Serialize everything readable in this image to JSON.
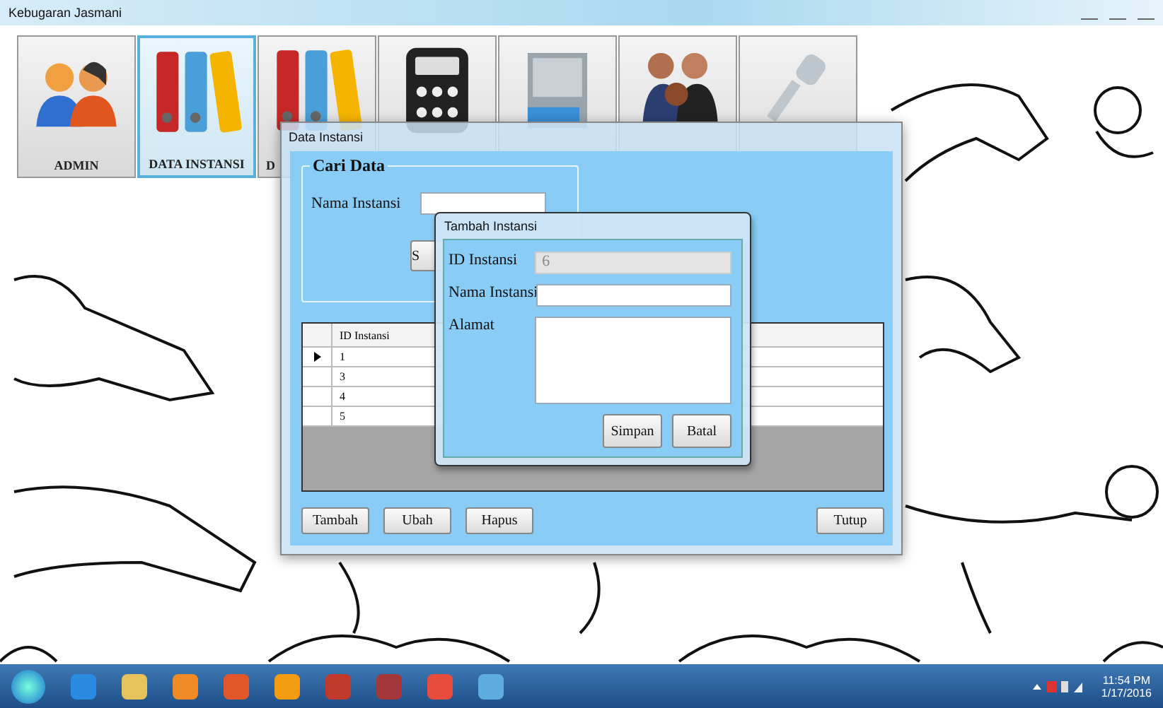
{
  "window": {
    "title": "Kebugaran Jasmani"
  },
  "menu_tiles": [
    {
      "kind": "people",
      "label": "ADMIN",
      "selected": false
    },
    {
      "kind": "binders",
      "label": "DATA INSTANSI",
      "selected": true
    },
    {
      "kind": "binders",
      "label": "D",
      "selected": false
    },
    {
      "kind": "calculator",
      "selected": false
    },
    {
      "kind": "cabinet",
      "selected": false
    },
    {
      "kind": "group",
      "selected": false
    },
    {
      "kind": "key",
      "selected": false
    }
  ],
  "data_window": {
    "title": "Data Instansi",
    "search_group": {
      "title": "Cari Data",
      "label": "Nama Instansi",
      "button": "S"
    },
    "grid": {
      "columns": [
        "ID Instansi"
      ],
      "rows": [
        {
          "cells": [
            "1"
          ],
          "selected": true
        },
        {
          "cells": [
            "3"
          ],
          "selected": false
        },
        {
          "cells": [
            "4"
          ],
          "selected": false
        },
        {
          "cells": [
            "5"
          ],
          "selected": false
        }
      ]
    },
    "buttons": [
      "Tambah",
      "Ubah",
      "Hapus"
    ],
    "close_button": "Tutup"
  },
  "dialog": {
    "title": "Tambah Instansi",
    "fields": [
      {
        "kind": "text",
        "label": "ID Instansi",
        "value": "6",
        "disabled": true
      },
      {
        "kind": "text",
        "label": "Nama Instansi",
        "disabled": false
      },
      {
        "kind": "multiline",
        "label": "Alamat",
        "disabled": false
      }
    ],
    "buttons": [
      "Simpan",
      "Batal"
    ]
  },
  "taskbar": {
    "clock": {
      "time": "11:54 PM",
      "date": "1/17/2016"
    }
  }
}
